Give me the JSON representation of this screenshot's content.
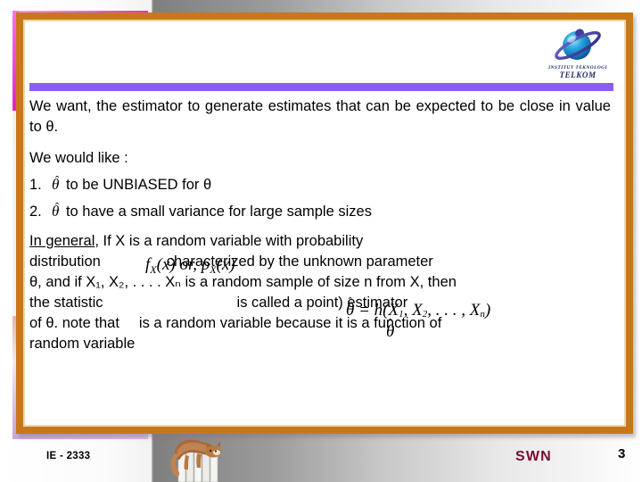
{
  "slide": {
    "logo": {
      "icon": "planet-globe-icon",
      "line1": "INSTITUT TEKNOLOGI",
      "line2": "TELKOM"
    },
    "body": {
      "para1": "We want, the estimator to generate estimates that can be expected to be close in value to θ.",
      "para2": "We would like :",
      "list": [
        {
          "num": "1.",
          "symbol": "θ",
          "hat": "ˆ",
          "text": "to be UNBIASED for θ"
        },
        {
          "num": "2.",
          "symbol": "θ",
          "hat": "ˆ",
          "text": "to have a small variance for large sample sizes"
        }
      ],
      "general_label": "In general",
      "line3_rest": ", If X is a random variable with probability",
      "line4_a": "distribution",
      "line4_b": "characterized by the unknown parameter",
      "line5": "θ, and if X₁, X₂, . . . . Xₙ is a random sample of size n from X, then",
      "line6_a": "the statistic",
      "line6_b": "is called a point) estimator",
      "line7_a": "of θ. note that",
      "line7_b": "is a random variable because it is a function of",
      "line8": "random variable"
    },
    "equations": {
      "density": "f",
      "density_sub": "X",
      "density_arg": "(x) or, p",
      "density_sub2": "X",
      "density_arg2": "(x)",
      "estimator_eq": "= h(X",
      "estimator_sub1": "1",
      "estimator_mid": ", X",
      "estimator_sub2": "2",
      "estimator_dots": ", . . . , X",
      "estimator_sub3": "n",
      "estimator_close": ")",
      "theta_symbol": "θ",
      "hat": "ˆ"
    },
    "footer": {
      "code": "IE - 2333",
      "author": "SWN",
      "page": "3",
      "clipart": "cat-on-fence-image"
    },
    "colors": {
      "frame": "#c8781a",
      "rule": "#8b5cf0",
      "accent": "#ec2bd6",
      "author": "#7a0b31",
      "logo_text": "#1d2a6b"
    }
  }
}
